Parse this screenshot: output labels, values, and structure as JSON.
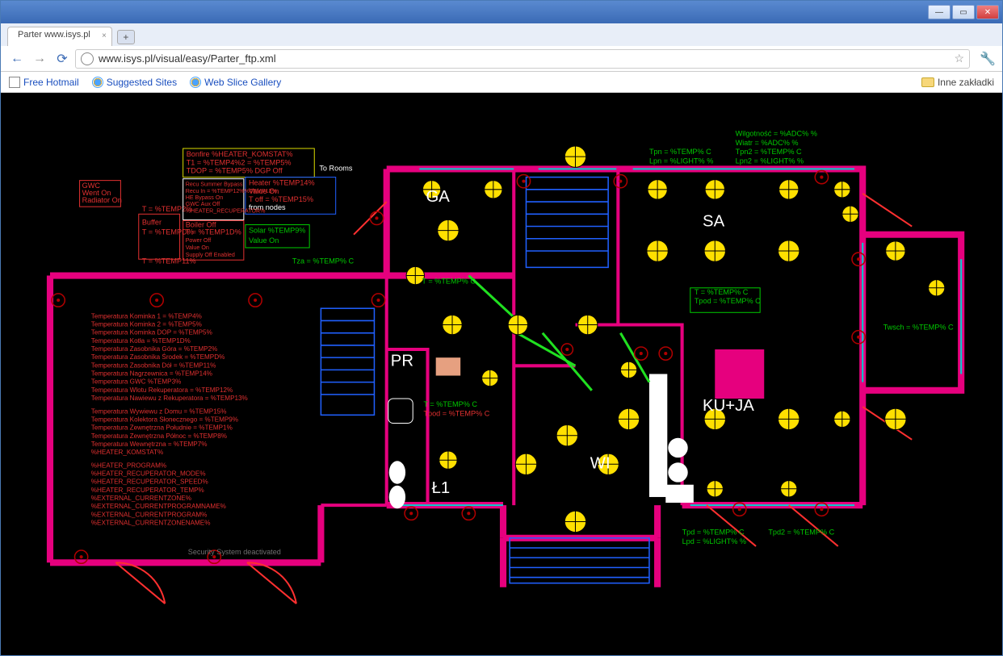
{
  "window": {
    "title": "Parter www.isys.pl"
  },
  "tab": {
    "label": "Parter www.isys.pl"
  },
  "url": "www.isys.pl/visual/easy/Parter_ftp.xml",
  "bookmarks": {
    "items": [
      "Free Hotmail",
      "Suggested Sites",
      "Web Slice Gallery"
    ],
    "other": "Inne zakładki"
  },
  "rooms": {
    "ga": "GA",
    "sa": "SA",
    "pr": "PR",
    "kuja": "KU+JA",
    "wi": "WI",
    "l1": "Ł1"
  },
  "top_right": {
    "wilg": "Wilgotność = %ADC% %",
    "wiatr": "Wiatr = %ADC% %",
    "tpn2": "Tpn2 = %TEMP% C",
    "lpn2": "Lpn2 = %LIGHT% %",
    "tpn": "Tpn = %TEMP% C",
    "lpn": "Lpn = %LIGHT% %"
  },
  "right_side": {
    "tsa": "T = %TEMP% C",
    "tpod_sa": "Tpod = %TEMP% C",
    "twsch": "Twsch = %TEMP% C"
  },
  "ga_temps": {
    "tza": "Tza = %TEMP% C",
    "tga": "T = %TEMP% C"
  },
  "pr_temps": {
    "t": "T = %TEMP% C",
    "tpod": "Tpod = %TEMP% C"
  },
  "bottom": {
    "tpd": "Tpd = %TEMP% C",
    "lpd": "Lpd = %LIGHT% %",
    "tpd2": "Tpd2 = %TEMP% C"
  },
  "bonfire": {
    "title": "Bonfire %HEATER_KOMSTAT%",
    "t1": "T1 = %TEMP4%2 = %TEMP5%",
    "tdop": "TDOP = %TEMP5% DGP Off"
  },
  "heater14": {
    "title": "Heater %TEMP14%",
    "value": "Value On",
    "toff": "T off = %TEMP15%",
    "node": "from nodes"
  },
  "to_rooms": "To Rooms",
  "gwc_box": {
    "l1": "GWC",
    "l2": "Went On",
    "l3": "Radiator On"
  },
  "buffer": {
    "title": "Buffer",
    "t": "T = %TEMPD%",
    "t2": "T = %TEMP2%",
    "t11": "T = %TEMP11%"
  },
  "recu": {
    "l1": "Recu   Summer Bypass",
    "l2": "Recu In = %TEMP12%%TEMP13%",
    "l3": "HE Bypass On",
    "l4": "GWC Aux Off",
    "l5": "%HEATER_RECUPERATOR%"
  },
  "boiler": {
    "title": "Boiler    Off",
    "t": "T = %TEMP1D%",
    "power": "Power Off",
    "value": "Value On",
    "supply": "Supply Off  Enabled"
  },
  "solar": {
    "title": "Solar %TEMP9%",
    "value": "Value On"
  },
  "temps_list": [
    "Temperatura Kominka 1 = %TEMP4%",
    "Temperatura Kominka 2 = %TEMP5%",
    "Temperatura Kominka DOP = %TEMP5%",
    "Temperatura Kotła = %TEMP1D%",
    "Temperatura Zasobnika Góra = %TEMP2%",
    "Temperatura Zasobnika Środek = %TEMPD%",
    "Temperatura Zasobnika Dół = %TEMP11%",
    "Temperatura Nagrzewnica = %TEMP14%",
    "Temperatura GWC %TEMP3%",
    "Temperatura Wlotu Rekuperatora = %TEMP12%",
    "Temperatura Nawiewu z Rekuperatora = %TEMP13%",
    "",
    "Temperatura Wywiewu z Domu = %TEMP15%",
    "Temperatura Kolektora Słonecznego = %TEMP9%",
    "Temperatura Zewnętrzna Południe = %TEMP1%",
    "Temperatura Zewnętrzna Północ = %TEMP8%",
    " Temperatura Wewnętrzna = %TEMP7%",
    "%HEATER_KOMSTAT%",
    "",
    "%HEATER_PROGRAM%",
    "%HEATER_RECUPERATOR_MODE%",
    "%HEATER_RECUPERATOR_SPEED%",
    "%HEATER_RECUPERATOR_TEMP%",
    "%EXTERNAL_CURRENTZONE%",
    " %EXTERNAL_CURRENTPROGRAMNAME%",
    "%EXTERNAL_CURRENTPROGRAM%",
    " %EXTERNAL_CURRENTZONENAME%"
  ],
  "security": "Security System deactivated"
}
